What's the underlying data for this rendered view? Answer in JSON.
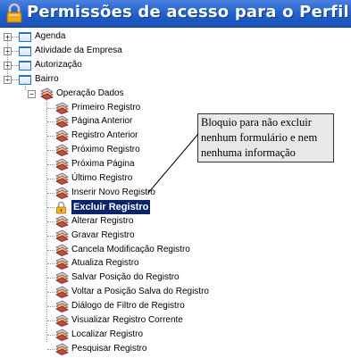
{
  "title": "Permissões de acesso para o Perfil",
  "tree": {
    "top_level": [
      {
        "label": "Agenda",
        "expander": "+"
      },
      {
        "label": "Atividade da Empresa",
        "expander": "+"
      },
      {
        "label": "Autorização",
        "expander": "+"
      },
      {
        "label": "Bairro",
        "expander": "−"
      }
    ],
    "group": {
      "label": "Operação Dados",
      "expander": "−"
    },
    "operations": [
      "Primeiro Registro",
      "Página Anterior",
      "Registro Anterior",
      "Próximo Registro",
      "Próxima Página",
      "Último Registro",
      "Inserir Novo Registro",
      "Excluir Registro",
      "Alterar Registro",
      "Gravar Registro",
      "Cancela Modificação Registro",
      "Atualiza Registro",
      "Salvar Posição do Registro",
      "Voltar a Posição Salva do Registro",
      "Diálogo de Filtro de Registro",
      "Visualizar Registro Corrente",
      "Localizar Registro",
      "Pesquisar Registro"
    ],
    "selected_operation": "Excluir Registro"
  },
  "callout": {
    "lines": [
      "Bloquio para não excluir",
      "nenhum formulário e nem",
      "nenhuma informação"
    ]
  },
  "colors": {
    "title_bar": "#1f5fc9",
    "selected_bg": "#0a246a",
    "lock_icon": "#e5a11a"
  }
}
